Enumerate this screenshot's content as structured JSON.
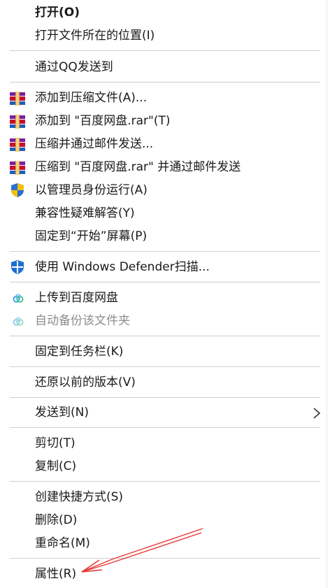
{
  "colors": {
    "text": "#1a1a1a",
    "disabled_text": "#8c8c8c",
    "separator": "#cfcfcf",
    "annotation_arrow": "#e53935",
    "defender_blue": "#1f6fd1",
    "uac_blue": "#2b6ed6",
    "uac_yellow": "#f2c200",
    "baidu_blue": "#2d9fe6",
    "baidu_green": "#41c47f",
    "winrar_red": "#c8102e"
  },
  "menu": {
    "open": "打开(O)",
    "open_location": "打开文件所在的位置(I)",
    "send_qq": "通过QQ发送到",
    "add_archive": "添加到压缩文件(A)...",
    "add_rar": "添加到 \"百度网盘.rar\"(T)",
    "compress_email": "压缩并通过邮件发送...",
    "compress_rar_email": "压缩到 \"百度网盘.rar\" 并通过邮件发送",
    "run_as_admin": "以管理员身份运行(A)",
    "compat_troubleshoot": "兼容性疑难解答(Y)",
    "pin_start": "固定到“开始”屏幕(P)",
    "defender_scan": "使用 Windows Defender扫描...",
    "upload_baidu": "上传到百度网盘",
    "auto_backup": "自动备份该文件夹",
    "pin_taskbar": "固定到任务栏(K)",
    "restore_versions": "还原以前的版本(V)",
    "send_to": "发送到(N)",
    "cut": "剪切(T)",
    "copy": "复制(C)",
    "create_shortcut": "创建快捷方式(S)",
    "delete": "删除(D)",
    "rename": "重命名(M)",
    "properties": "属性(R)"
  },
  "icons": {
    "winrar": "winrar-archive-icon",
    "uac": "uac-shield-icon",
    "defender": "windows-defender-shield-icon",
    "baidu": "baidu-netdisk-cloud-icon",
    "submenu": "chevron-right-icon",
    "annotation": "red-arrow-annotation"
  }
}
